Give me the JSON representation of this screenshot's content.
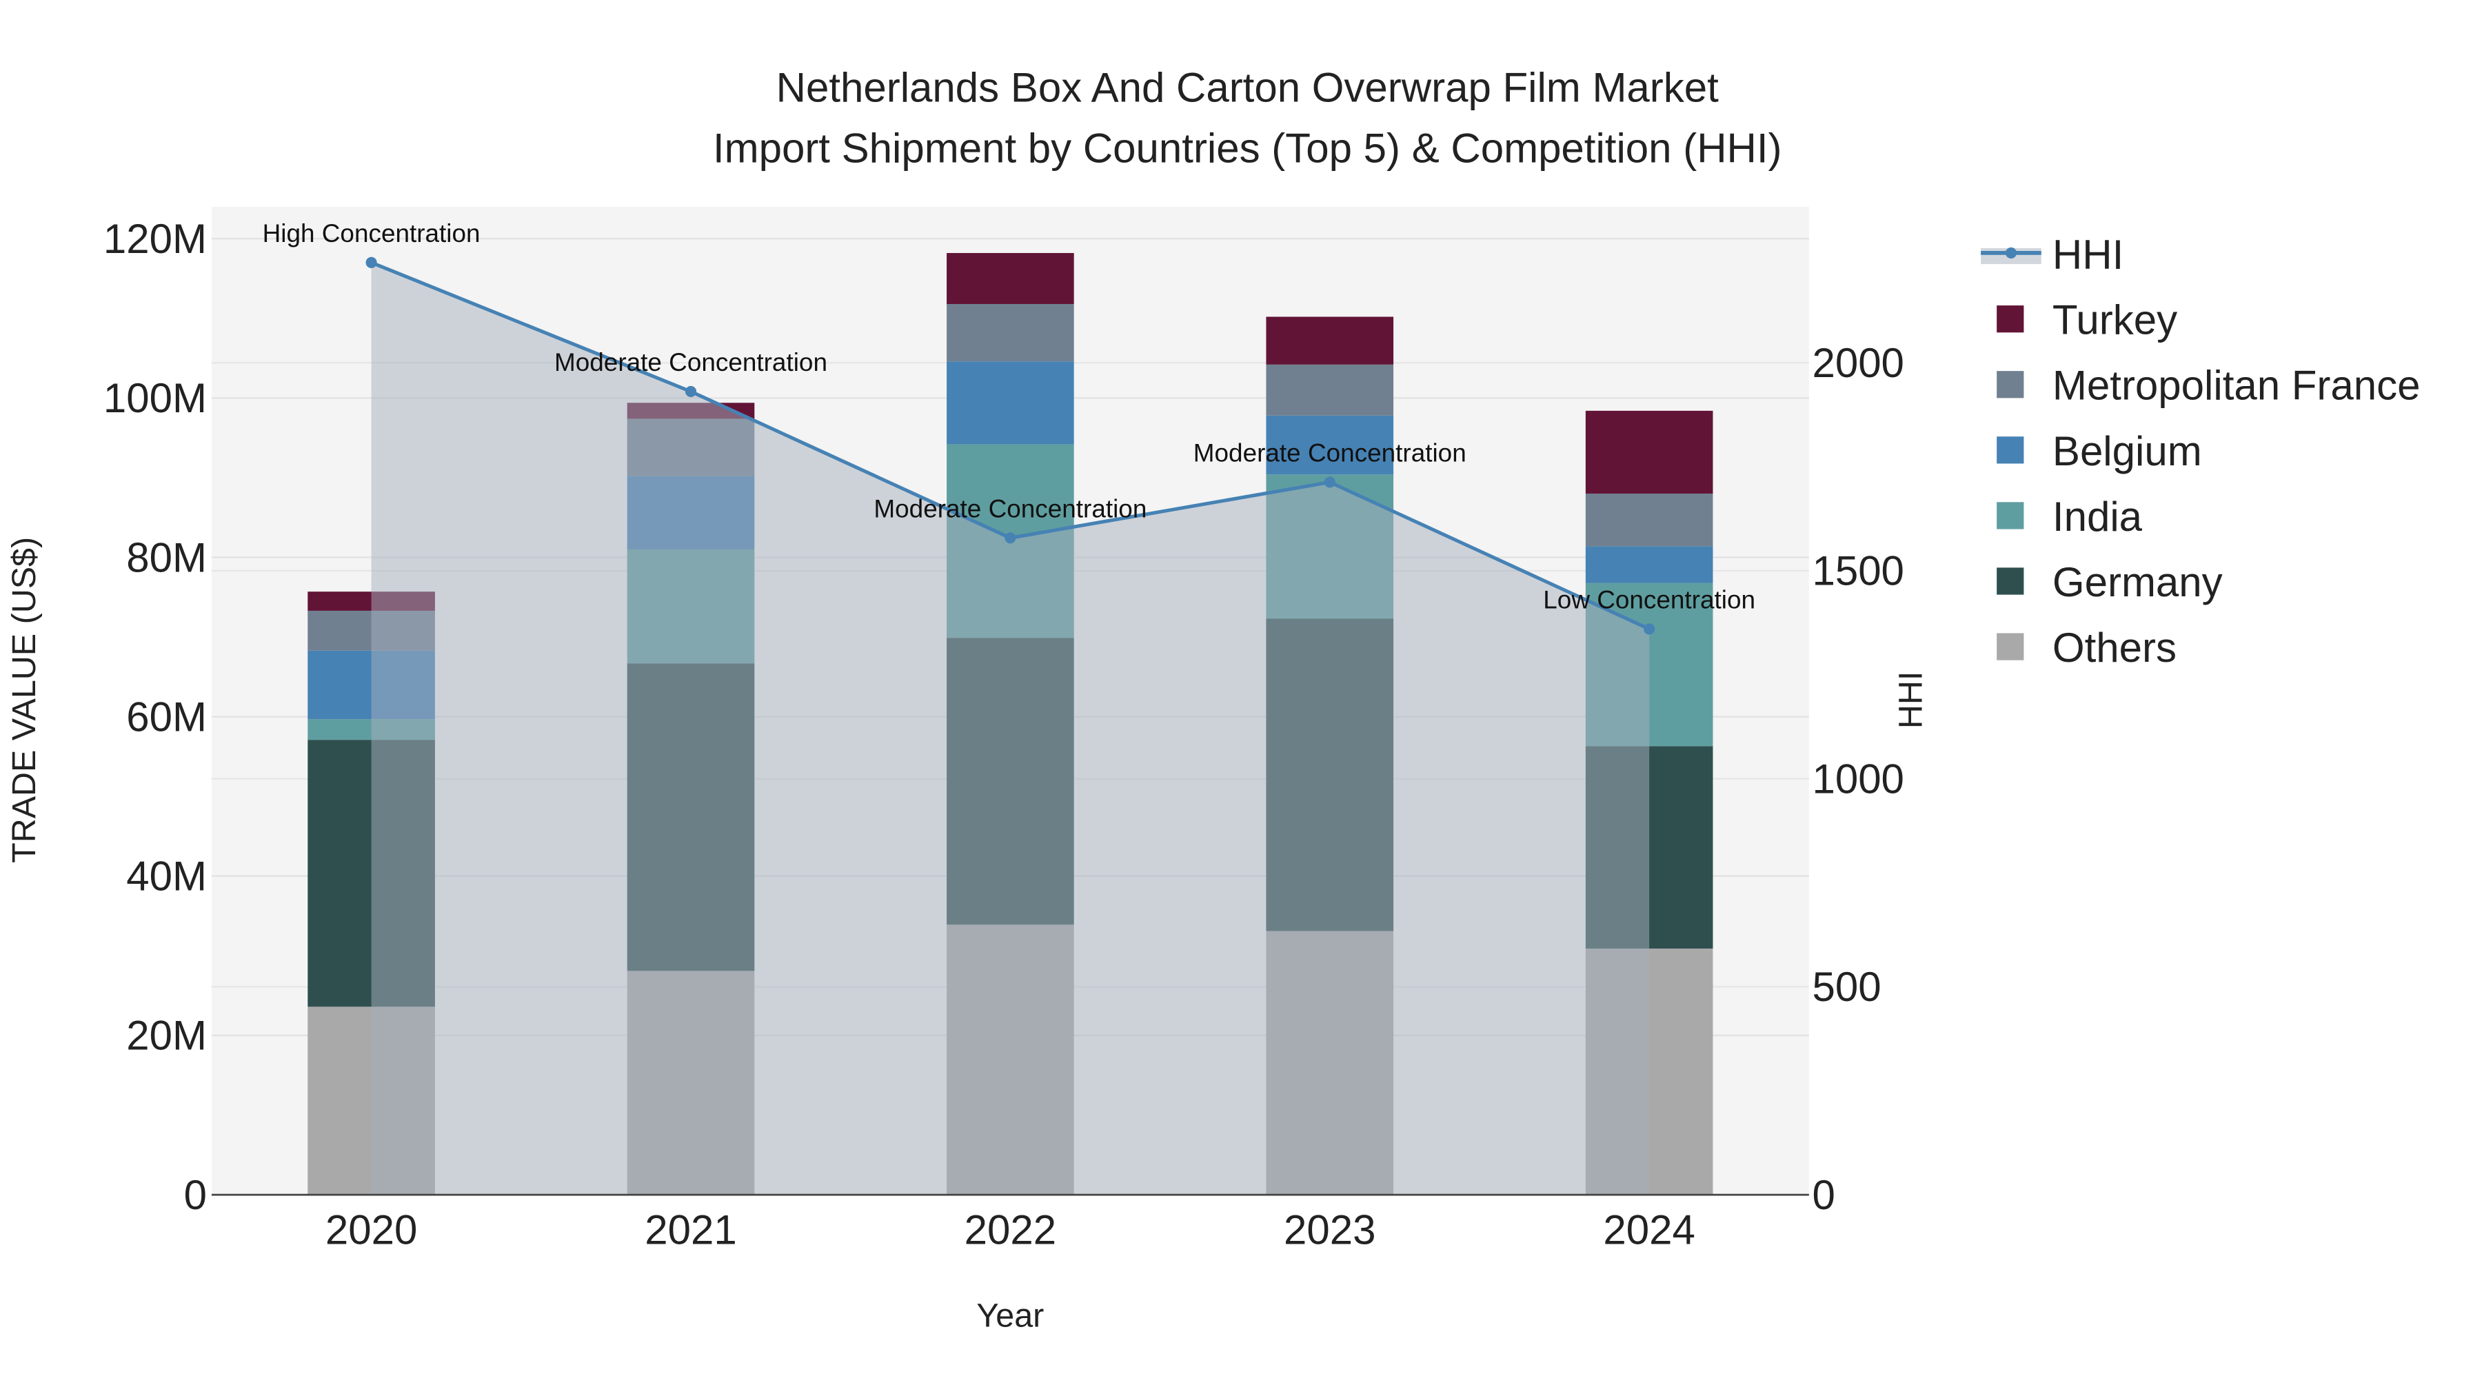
{
  "chart_data": {
    "type": "bar",
    "title_line1": "Netherlands Box And Carton Overwrap Film Market",
    "title_line2": "Import Shipment by Countries (Top 5) & Competition (HHI)",
    "xlabel": "Year",
    "ylabel": "TRADE VALUE (US$)",
    "y2label": "HHI",
    "categories": [
      "2020",
      "2021",
      "2022",
      "2023",
      "2024"
    ],
    "ylim": [
      0,
      124
    ],
    "y_ticks": [
      0,
      20,
      40,
      60,
      80,
      100,
      120
    ],
    "y_tick_labels": [
      "0",
      "20M",
      "40M",
      "60M",
      "80M",
      "100M",
      "120M"
    ],
    "y2lim": [
      0,
      2375
    ],
    "y2_ticks": [
      0,
      500,
      1000,
      1500,
      2000
    ],
    "y2_tick_labels": [
      "0",
      "500",
      "1000",
      "1500",
      "2000"
    ],
    "series": [
      {
        "name": "Others",
        "color": "#a9a9a9",
        "values": [
          23.6,
          28.1,
          33.9,
          33.1,
          30.9
        ]
      },
      {
        "name": "Germany",
        "color": "#2f4f4f",
        "values": [
          33.5,
          38.6,
          36.0,
          39.2,
          25.4
        ]
      },
      {
        "name": "India",
        "color": "#5f9ea0",
        "values": [
          2.6,
          14.3,
          24.3,
          18.1,
          20.5
        ]
      },
      {
        "name": "Belgium",
        "color": "#4682b4",
        "values": [
          8.6,
          9.2,
          10.4,
          7.4,
          4.6
        ]
      },
      {
        "name": "Metropolitan France",
        "color": "#708090",
        "values": [
          5.0,
          7.2,
          7.2,
          6.4,
          6.6
        ]
      },
      {
        "name": "Turkey",
        "color": "#621436",
        "values": [
          2.4,
          2.0,
          6.4,
          6.0,
          10.4
        ]
      }
    ],
    "hhi": {
      "name": "HHI",
      "color": "#4682b4",
      "values": [
        2241,
        1931,
        1579,
        1713,
        1360
      ],
      "annotations": [
        "High Concentration",
        "Moderate Concentration",
        "Moderate Concentration",
        "Moderate Concentration",
        "Low Concentration"
      ]
    },
    "legend_position": "right",
    "grid": true
  }
}
